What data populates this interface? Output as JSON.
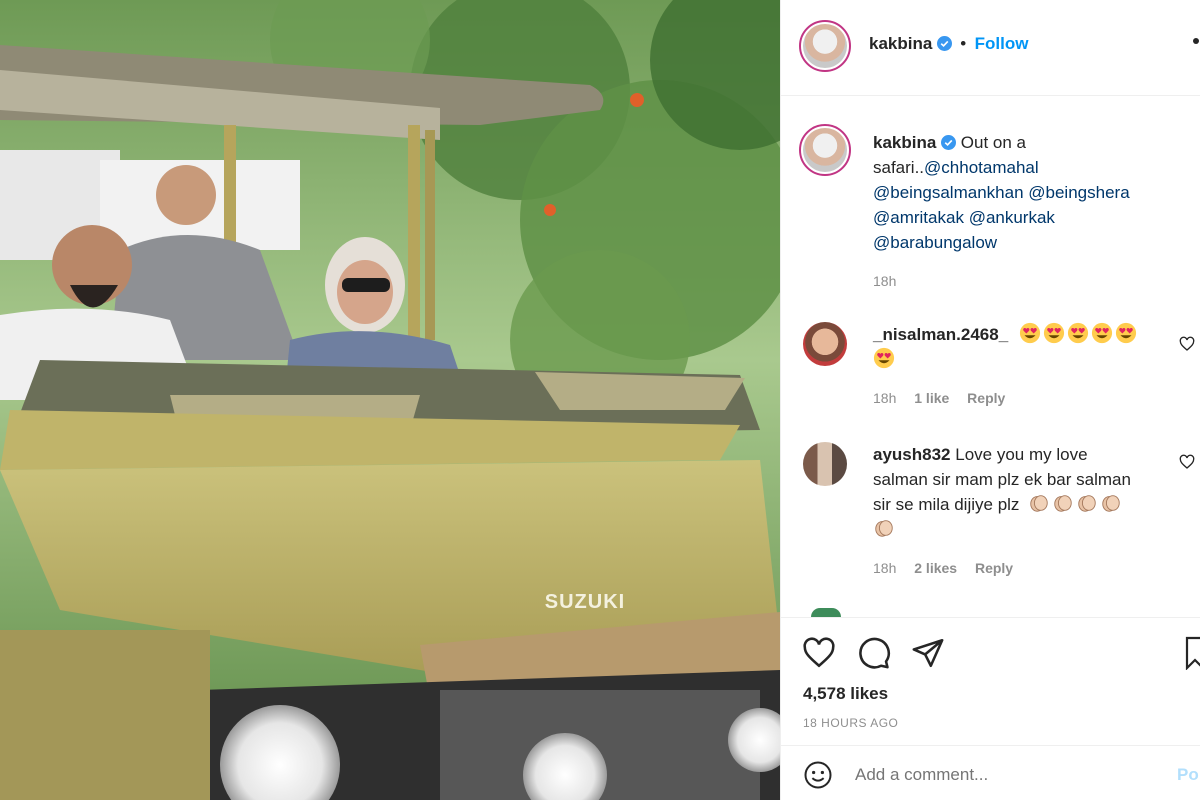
{
  "post": {
    "image_alt_icon": "photo-safari-jeep",
    "author": {
      "username": "kakbina",
      "verified_icon": "verified-badge-icon",
      "follow_label": "Follow",
      "separator": "•"
    },
    "caption": {
      "username": "kakbina",
      "text_1": "Out on a",
      "text_2": "safari..",
      "mentions": [
        "@chhotamahal",
        "@beingsalmankhan",
        "@beingshera",
        "@amritakak",
        "@ankurkak",
        "@barabungalow"
      ],
      "time": "18h"
    },
    "comments": [
      {
        "username": "_nisalman.2468_",
        "text": "",
        "emoji": "heart-eyes-emoji",
        "emoji_count": 6,
        "time": "18h",
        "likes": "1 like",
        "reply": "Reply"
      },
      {
        "username": "ayush832",
        "text_1": "Love you my love",
        "text_2": "salman sir mam plz ek bar salman",
        "text_3": "sir se mila dijiye plz",
        "emoji": "clapping-hands-emoji",
        "emoji_count": 5,
        "time": "18h",
        "likes": "2 likes",
        "reply": "Reply"
      }
    ],
    "likes": "4,578 likes",
    "time_ago": "18 HOURS AGO",
    "add_comment_placeholder": "Add a comment...",
    "post_label": "Po"
  },
  "colors": {
    "accent": "#0095f6",
    "text": "#262626",
    "muted": "#8e8e8e",
    "mention": "#00376b",
    "story_ring": "#c13584"
  }
}
